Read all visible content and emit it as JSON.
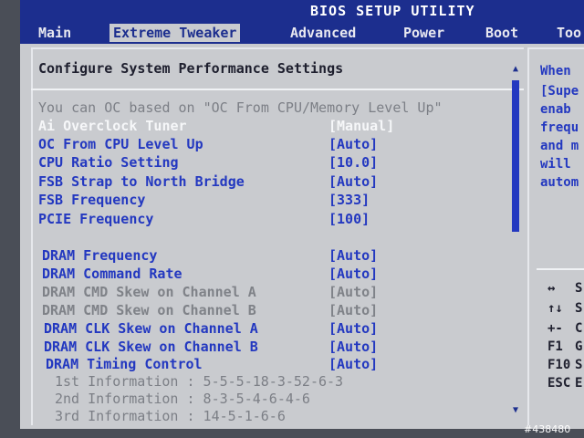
{
  "window": {
    "title": "BIOS SETUP UTILITY"
  },
  "menu": [
    {
      "label": "Main",
      "active": false
    },
    {
      "label": "Extreme Tweaker",
      "active": true
    },
    {
      "label": "Advanced",
      "active": false
    },
    {
      "label": "Power",
      "active": false
    },
    {
      "label": "Boot",
      "active": false
    },
    {
      "label": "Too",
      "active": false
    }
  ],
  "panel": {
    "title": "Configure System Performance Settings",
    "note": "You can OC based on \"OC From CPU/Memory Level Up\"",
    "settings": [
      {
        "label": "Ai Overclock Tuner",
        "value": "[Manual]",
        "state": "selected"
      },
      {
        "label": "OC From CPU Level Up",
        "value": "[Auto]",
        "state": "editable"
      },
      {
        "label": "CPU Ratio Setting",
        "value": "[10.0]",
        "state": "editable"
      },
      {
        "label": "FSB Strap to North Bridge",
        "value": "[Auto]",
        "state": "editable"
      },
      {
        "label": "FSB Frequency",
        "value": "[333]",
        "state": "editable"
      },
      {
        "label": "PCIE Frequency",
        "value": "[100]",
        "state": "editable"
      },
      {
        "label": "DRAM Frequency",
        "value": "[Auto]",
        "state": "editable"
      },
      {
        "label": "DRAM Command Rate",
        "value": "[Auto]",
        "state": "editable"
      },
      {
        "label": "DRAM CMD Skew on Channel A",
        "value": "[Auto]",
        "state": "disabled"
      },
      {
        "label": "DRAM CMD Skew on Channel B",
        "value": "[Auto]",
        "state": "disabled"
      },
      {
        "label": "DRAM CLK Skew on Channel A",
        "value": "[Auto]",
        "state": "editable"
      },
      {
        "label": "DRAM CLK Skew on Channel B",
        "value": "[Auto]",
        "state": "editable"
      },
      {
        "label": "DRAM Timing Control",
        "value": "[Auto]",
        "state": "editable"
      }
    ],
    "info": [
      "1st Information : 5-5-5-18-3-52-6-3",
      "2nd Information : 8-3-5-4-6-4-6",
      "3rd Information : 14-5-1-6-6"
    ]
  },
  "help": {
    "lines": [
      "When",
      "[Supe",
      "enab",
      "frequ",
      "and m",
      "will",
      "autom"
    ],
    "keys": [
      {
        "key": "↔",
        "desc": "S"
      },
      {
        "key": "↑↓",
        "desc": "S"
      },
      {
        "key": "+-",
        "desc": "C"
      },
      {
        "key": "F1",
        "desc": "G"
      },
      {
        "key": "F10",
        "desc": "S"
      },
      {
        "key": "ESC",
        "desc": "E"
      }
    ]
  },
  "watermark": "#438480",
  "colors": {
    "bios_blue": "#1c2e8e",
    "item_blue": "#2338c0",
    "panel_gray": "#c9cbcf",
    "disabled_gray": "#7f8288"
  },
  "icons": {
    "scroll_up": "triangle-up",
    "scroll_down": "triangle-down"
  }
}
